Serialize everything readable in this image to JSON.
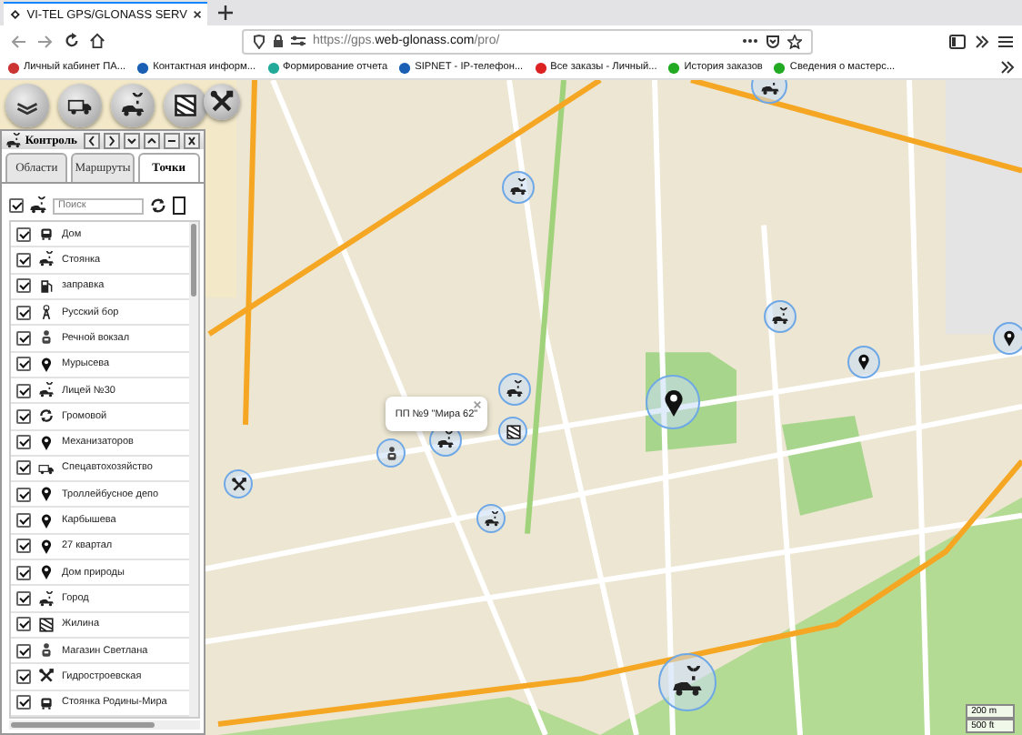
{
  "browser": {
    "tab": {
      "title": "VI-TEL GPS/GLONASS SERV"
    },
    "url": {
      "prefix": "https://gps.",
      "domain": "web-glonass.com",
      "suffix": "/pro/"
    },
    "bookmarks": [
      {
        "label": "Личный кабинет ПА..."
      },
      {
        "label": "Контактная информ..."
      },
      {
        "label": "Формирование отчета"
      },
      {
        "label": "SIPNET - IP-телефон..."
      },
      {
        "label": "Все заказы - Личный..."
      },
      {
        "label": "История заказов"
      },
      {
        "label": "Сведения о мастерс..."
      }
    ]
  },
  "panel": {
    "title": "Контроль",
    "tabs": [
      {
        "label": "Области",
        "selected": false
      },
      {
        "label": "Маршруты",
        "selected": false
      },
      {
        "label": "Точки",
        "selected": true
      }
    ],
    "search": {
      "placeholder": "Поиск"
    },
    "select_all": {
      "checked": true
    },
    "points": [
      {
        "name": "Дом",
        "checked": true
      },
      {
        "name": "Стоянка",
        "checked": true
      },
      {
        "name": "заправка",
        "checked": true
      },
      {
        "name": "Русский бор",
        "checked": true
      },
      {
        "name": "Речной вокзал",
        "checked": true
      },
      {
        "name": "Мурысева",
        "checked": true
      },
      {
        "name": "Лицей №30",
        "checked": true
      },
      {
        "name": "Громовой",
        "checked": true
      },
      {
        "name": "Механизаторов",
        "checked": true
      },
      {
        "name": "Спецавтохозяйство",
        "checked": true
      },
      {
        "name": "Троллейбусное депо",
        "checked": true
      },
      {
        "name": "Карбышева",
        "checked": true
      },
      {
        "name": "27 квартал",
        "checked": true
      },
      {
        "name": "Дом природы",
        "checked": true
      },
      {
        "name": "Город",
        "checked": true
      },
      {
        "name": "Жилина",
        "checked": true
      },
      {
        "name": "Магазин Светлана",
        "checked": true
      },
      {
        "name": "Гидростроевская",
        "checked": true
      },
      {
        "name": "Стоянка Родины-Мира",
        "checked": true
      }
    ]
  },
  "map": {
    "popup": {
      "text": "ПП №9 \"Мира 62\""
    },
    "scale": [
      "200 m",
      "500 ft"
    ]
  }
}
